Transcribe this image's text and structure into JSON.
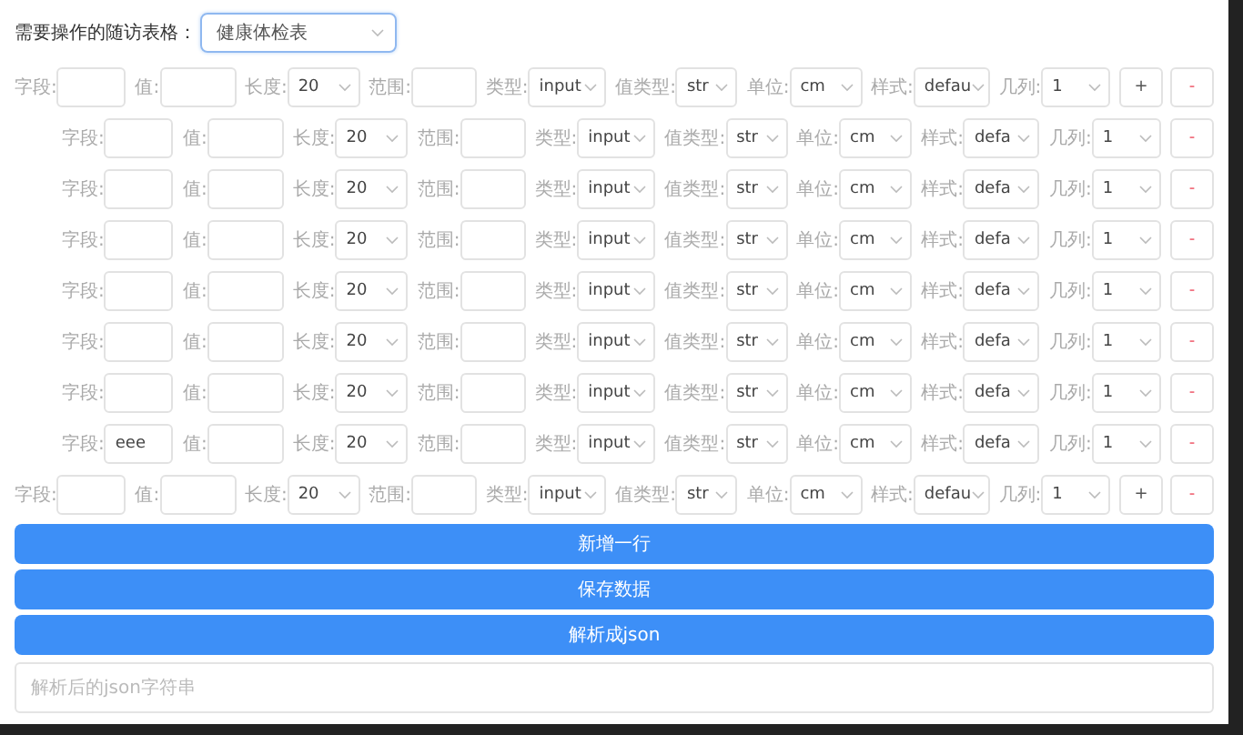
{
  "form_select": {
    "label": "需要操作的随访表格：",
    "value": "健康体检表"
  },
  "rows": [
    {
      "kind": "outer",
      "cells": [
        {
          "label": "字段:",
          "kind": "input"
        },
        {
          "label": "值:",
          "kind": "input"
        },
        {
          "label": "长度:",
          "kind": "select",
          "value": "20"
        },
        {
          "label": "范围:",
          "kind": "input"
        },
        {
          "label": "类型:",
          "kind": "select",
          "value": "input"
        },
        {
          "label": "值类型:",
          "kind": "select",
          "value": "str"
        },
        {
          "label": "单位:",
          "kind": "select",
          "value": "cm"
        },
        {
          "label": "样式:",
          "kind": "select",
          "value": "defau"
        },
        {
          "label": "几列:",
          "kind": "select",
          "value": "1"
        }
      ],
      "buttons": [
        "+",
        "-"
      ]
    },
    {
      "kind": "nested",
      "cells": [
        {
          "label": "字段:",
          "kind": "input"
        },
        {
          "label": "值:",
          "kind": "input"
        },
        {
          "label": "长度:",
          "kind": "select",
          "value": "20"
        },
        {
          "label": "范围:",
          "kind": "input"
        },
        {
          "label": "类型:",
          "kind": "select",
          "value": "input"
        },
        {
          "label": "值类型:",
          "kind": "select",
          "value": "str"
        },
        {
          "label": "单位:",
          "kind": "select",
          "value": "cm"
        },
        {
          "label": "样式:",
          "kind": "select",
          "value": "defa"
        },
        {
          "label": "几列:",
          "kind": "select",
          "value": "1"
        }
      ],
      "buttons": [
        "-"
      ]
    },
    {
      "kind": "nested",
      "cells": [
        {
          "label": "字段:",
          "kind": "input"
        },
        {
          "label": "值:",
          "kind": "input"
        },
        {
          "label": "长度:",
          "kind": "select",
          "value": "20"
        },
        {
          "label": "范围:",
          "kind": "input"
        },
        {
          "label": "类型:",
          "kind": "select",
          "value": "input"
        },
        {
          "label": "值类型:",
          "kind": "select",
          "value": "str"
        },
        {
          "label": "单位:",
          "kind": "select",
          "value": "cm"
        },
        {
          "label": "样式:",
          "kind": "select",
          "value": "defa"
        },
        {
          "label": "几列:",
          "kind": "select",
          "value": "1"
        }
      ],
      "buttons": [
        "-"
      ]
    },
    {
      "kind": "nested",
      "cells": [
        {
          "label": "字段:",
          "kind": "input"
        },
        {
          "label": "值:",
          "kind": "input"
        },
        {
          "label": "长度:",
          "kind": "select",
          "value": "20"
        },
        {
          "label": "范围:",
          "kind": "input"
        },
        {
          "label": "类型:",
          "kind": "select",
          "value": "input"
        },
        {
          "label": "值类型:",
          "kind": "select",
          "value": "str"
        },
        {
          "label": "单位:",
          "kind": "select",
          "value": "cm"
        },
        {
          "label": "样式:",
          "kind": "select",
          "value": "defa"
        },
        {
          "label": "几列:",
          "kind": "select",
          "value": "1"
        }
      ],
      "buttons": [
        "-"
      ]
    },
    {
      "kind": "nested",
      "cells": [
        {
          "label": "字段:",
          "kind": "input"
        },
        {
          "label": "值:",
          "kind": "input"
        },
        {
          "label": "长度:",
          "kind": "select",
          "value": "20"
        },
        {
          "label": "范围:",
          "kind": "input"
        },
        {
          "label": "类型:",
          "kind": "select",
          "value": "input"
        },
        {
          "label": "值类型:",
          "kind": "select",
          "value": "str"
        },
        {
          "label": "单位:",
          "kind": "select",
          "value": "cm"
        },
        {
          "label": "样式:",
          "kind": "select",
          "value": "defa"
        },
        {
          "label": "几列:",
          "kind": "select",
          "value": "1"
        }
      ],
      "buttons": [
        "-"
      ]
    },
    {
      "kind": "nested",
      "cells": [
        {
          "label": "字段:",
          "kind": "input"
        },
        {
          "label": "值:",
          "kind": "input"
        },
        {
          "label": "长度:",
          "kind": "select",
          "value": "20"
        },
        {
          "label": "范围:",
          "kind": "input"
        },
        {
          "label": "类型:",
          "kind": "select",
          "value": "input"
        },
        {
          "label": "值类型:",
          "kind": "select",
          "value": "str"
        },
        {
          "label": "单位:",
          "kind": "select",
          "value": "cm"
        },
        {
          "label": "样式:",
          "kind": "select",
          "value": "defa"
        },
        {
          "label": "几列:",
          "kind": "select",
          "value": "1"
        }
      ],
      "buttons": [
        "-"
      ]
    },
    {
      "kind": "nested",
      "cells": [
        {
          "label": "字段:",
          "kind": "input"
        },
        {
          "label": "值:",
          "kind": "input"
        },
        {
          "label": "长度:",
          "kind": "select",
          "value": "20"
        },
        {
          "label": "范围:",
          "kind": "input"
        },
        {
          "label": "类型:",
          "kind": "select",
          "value": "input"
        },
        {
          "label": "值类型:",
          "kind": "select",
          "value": "str"
        },
        {
          "label": "单位:",
          "kind": "select",
          "value": "cm"
        },
        {
          "label": "样式:",
          "kind": "select",
          "value": "defa"
        },
        {
          "label": "几列:",
          "kind": "select",
          "value": "1"
        }
      ],
      "buttons": [
        "-"
      ]
    },
    {
      "kind": "nested",
      "cells": [
        {
          "label": "字段:",
          "kind": "input",
          "value": "eee"
        },
        {
          "label": "值:",
          "kind": "input"
        },
        {
          "label": "长度:",
          "kind": "select",
          "value": "20"
        },
        {
          "label": "范围:",
          "kind": "input"
        },
        {
          "label": "类型:",
          "kind": "select",
          "value": "input"
        },
        {
          "label": "值类型:",
          "kind": "select",
          "value": "str"
        },
        {
          "label": "单位:",
          "kind": "select",
          "value": "cm"
        },
        {
          "label": "样式:",
          "kind": "select",
          "value": "defa"
        },
        {
          "label": "几列:",
          "kind": "select",
          "value": "1"
        }
      ],
      "buttons": [
        "-"
      ]
    },
    {
      "kind": "outer",
      "cells": [
        {
          "label": "字段:",
          "kind": "input"
        },
        {
          "label": "值:",
          "kind": "input"
        },
        {
          "label": "长度:",
          "kind": "select",
          "value": "20"
        },
        {
          "label": "范围:",
          "kind": "input"
        },
        {
          "label": "类型:",
          "kind": "select",
          "value": "input"
        },
        {
          "label": "值类型:",
          "kind": "select",
          "value": "str"
        },
        {
          "label": "单位:",
          "kind": "select",
          "value": "cm"
        },
        {
          "label": "样式:",
          "kind": "select",
          "value": "defau"
        },
        {
          "label": "几列:",
          "kind": "select",
          "value": "1"
        }
      ],
      "buttons": [
        "+",
        "-"
      ]
    }
  ],
  "actions": [
    "新增一行",
    "保存数据",
    "解析成json"
  ],
  "output": {
    "placeholder": "解析后的json字符串"
  }
}
